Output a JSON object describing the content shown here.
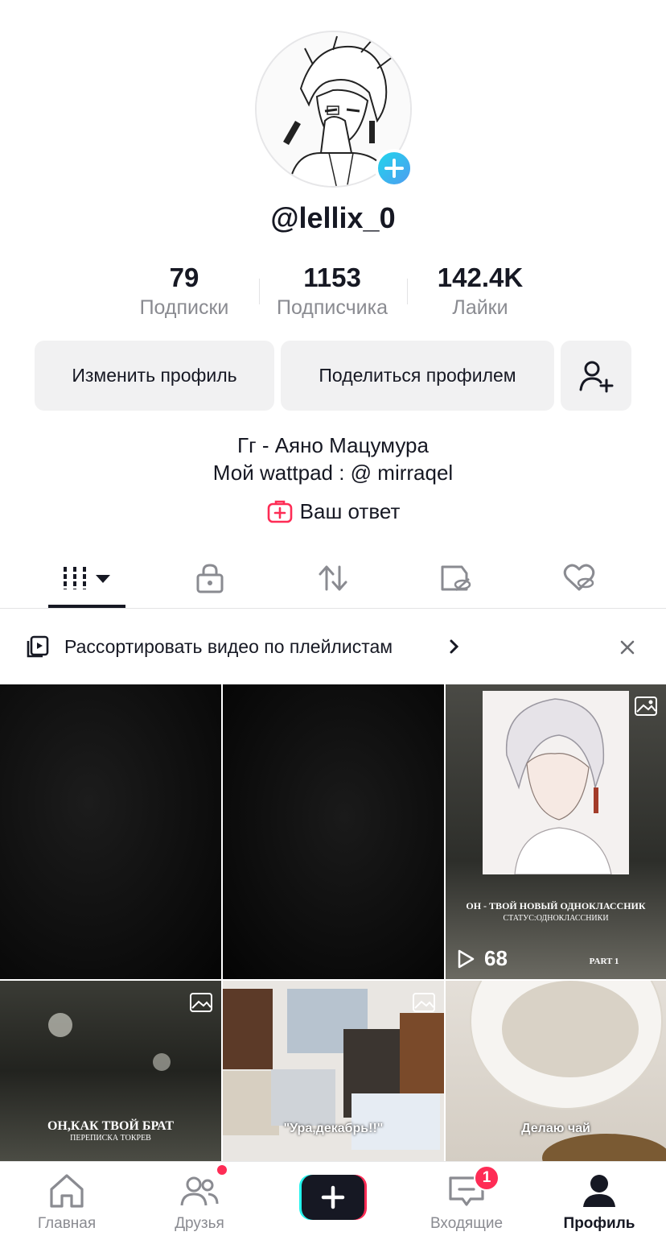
{
  "profile": {
    "username": "@lellix_0",
    "stats": [
      {
        "value": "79",
        "label": "Подписки"
      },
      {
        "value": "1153",
        "label": "Подписчика"
      },
      {
        "value": "142.4K",
        "label": "Лайки"
      }
    ],
    "edit_button": "Изменить профиль",
    "share_button": "Поделиться профилем",
    "bio_line1": "Гг - Аяно Мацумура",
    "bio_line2": "Мой wattpad : @ mirraqel",
    "answer_label": "Ваш ответ"
  },
  "tabs": [
    {
      "icon": "grid-icon",
      "active": true
    },
    {
      "icon": "lock-icon"
    },
    {
      "icon": "repost-icon"
    },
    {
      "icon": "bookmark-hidden-icon"
    },
    {
      "icon": "liked-hidden-icon"
    }
  ],
  "playlist_banner": {
    "text": "Рассортировать видео по плейлистам",
    "chevron": "›",
    "close": "×"
  },
  "videos": [
    {
      "caption": "",
      "views": ""
    },
    {
      "caption": "",
      "views": ""
    },
    {
      "caption_line1": "ОН - ТВОЙ НОВЫЙ ОДНОКЛАССНИК",
      "caption_line2": "СТАТУС:ОДНОКЛАССНИКИ",
      "part": "PART 1",
      "views": "68"
    },
    {
      "caption_line1": "ОН,КАК ТВОЙ БРАТ",
      "caption_line2": "ПЕРЕПИСКА ТОКРЕВ"
    },
    {
      "caption": "\"Ура,декабрь!!\""
    },
    {
      "caption": "Делаю чай"
    }
  ],
  "bottom_nav": {
    "home": "Главная",
    "friends": "Друзья",
    "create": "+",
    "inbox": "Входящие",
    "inbox_badge": "1",
    "profile": "Профиль"
  },
  "colors": {
    "accent_red": "#fe2c55",
    "accent_cyan": "#20d5ec",
    "button_bg": "#f1f1f2",
    "muted_text": "#8a8b91"
  }
}
